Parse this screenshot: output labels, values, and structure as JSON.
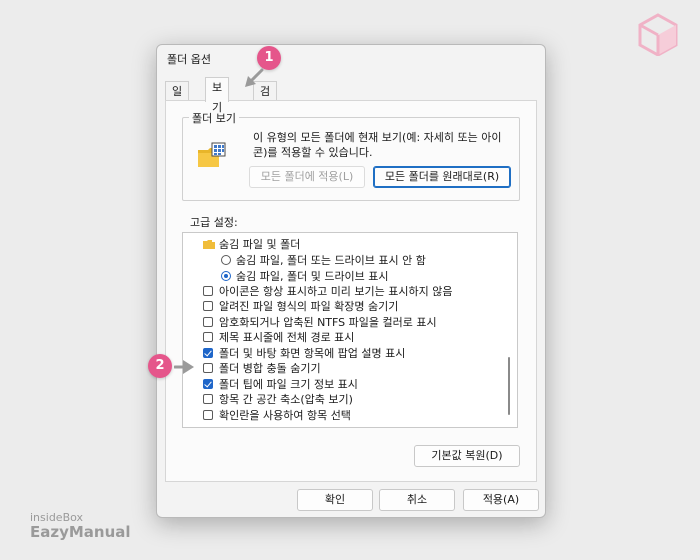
{
  "dialog": {
    "title": "폴더 옵션",
    "tabs": [
      {
        "label": "일반",
        "active": false
      },
      {
        "label": "보기",
        "active": true
      },
      {
        "label": "검색",
        "active": false
      }
    ]
  },
  "folder_view": {
    "group_title": "폴더 보기",
    "description": "이 유형의 모든 폴더에 현재 보기(예: 자세히 또는 아이콘)를 적용할 수 있습니다.",
    "apply_button": "모든 폴더에 적용(L)",
    "reset_button": "모든 폴더를 원래대로(R)"
  },
  "advanced": {
    "label": "고급 설정:",
    "items": [
      {
        "type": "folder",
        "label": "숨김 파일 및 폴더"
      },
      {
        "type": "radio",
        "checked": false,
        "label": "숨김 파일, 폴더 또는 드라이브 표시 안 함"
      },
      {
        "type": "radio",
        "checked": true,
        "label": "숨김 파일, 폴더 및 드라이브 표시"
      },
      {
        "type": "checkbox",
        "checked": false,
        "label": "아이콘은 항상 표시하고 미리 보기는 표시하지 않음"
      },
      {
        "type": "checkbox",
        "checked": false,
        "label": "알려진 파일 형식의 파일 확장명 숨기기"
      },
      {
        "type": "checkbox",
        "checked": false,
        "label": "암호화되거나 압축된 NTFS 파일을 컬러로 표시"
      },
      {
        "type": "checkbox",
        "checked": false,
        "label": "제목 표시줄에 전체 경로 표시"
      },
      {
        "type": "checkbox",
        "checked": true,
        "label": "폴더 및 바탕 화면 항목에 팝업 설명 표시"
      },
      {
        "type": "checkbox",
        "checked": false,
        "label": "폴더 병합 충돌 숨기기"
      },
      {
        "type": "checkbox",
        "checked": true,
        "label": "폴더 팁에 파일 크기 정보 표시"
      },
      {
        "type": "checkbox",
        "checked": false,
        "label": "항목 간 공간 축소(압축 보기)"
      },
      {
        "type": "checkbox",
        "checked": false,
        "label": "확인란을 사용하여 항목 선택"
      }
    ]
  },
  "restore_defaults": "기본값 복원(D)",
  "footer": {
    "ok": "확인",
    "cancel": "취소",
    "apply": "적용(A)"
  },
  "badges": [
    "1",
    "2"
  ],
  "watermark": {
    "line1": "insideBox",
    "line2": "EazyManual"
  },
  "colors": {
    "accent": "#1f66c9",
    "badge": "#e5568b"
  },
  "icons": {
    "folder": "folder-icon",
    "logo": "cube-logo-icon"
  }
}
